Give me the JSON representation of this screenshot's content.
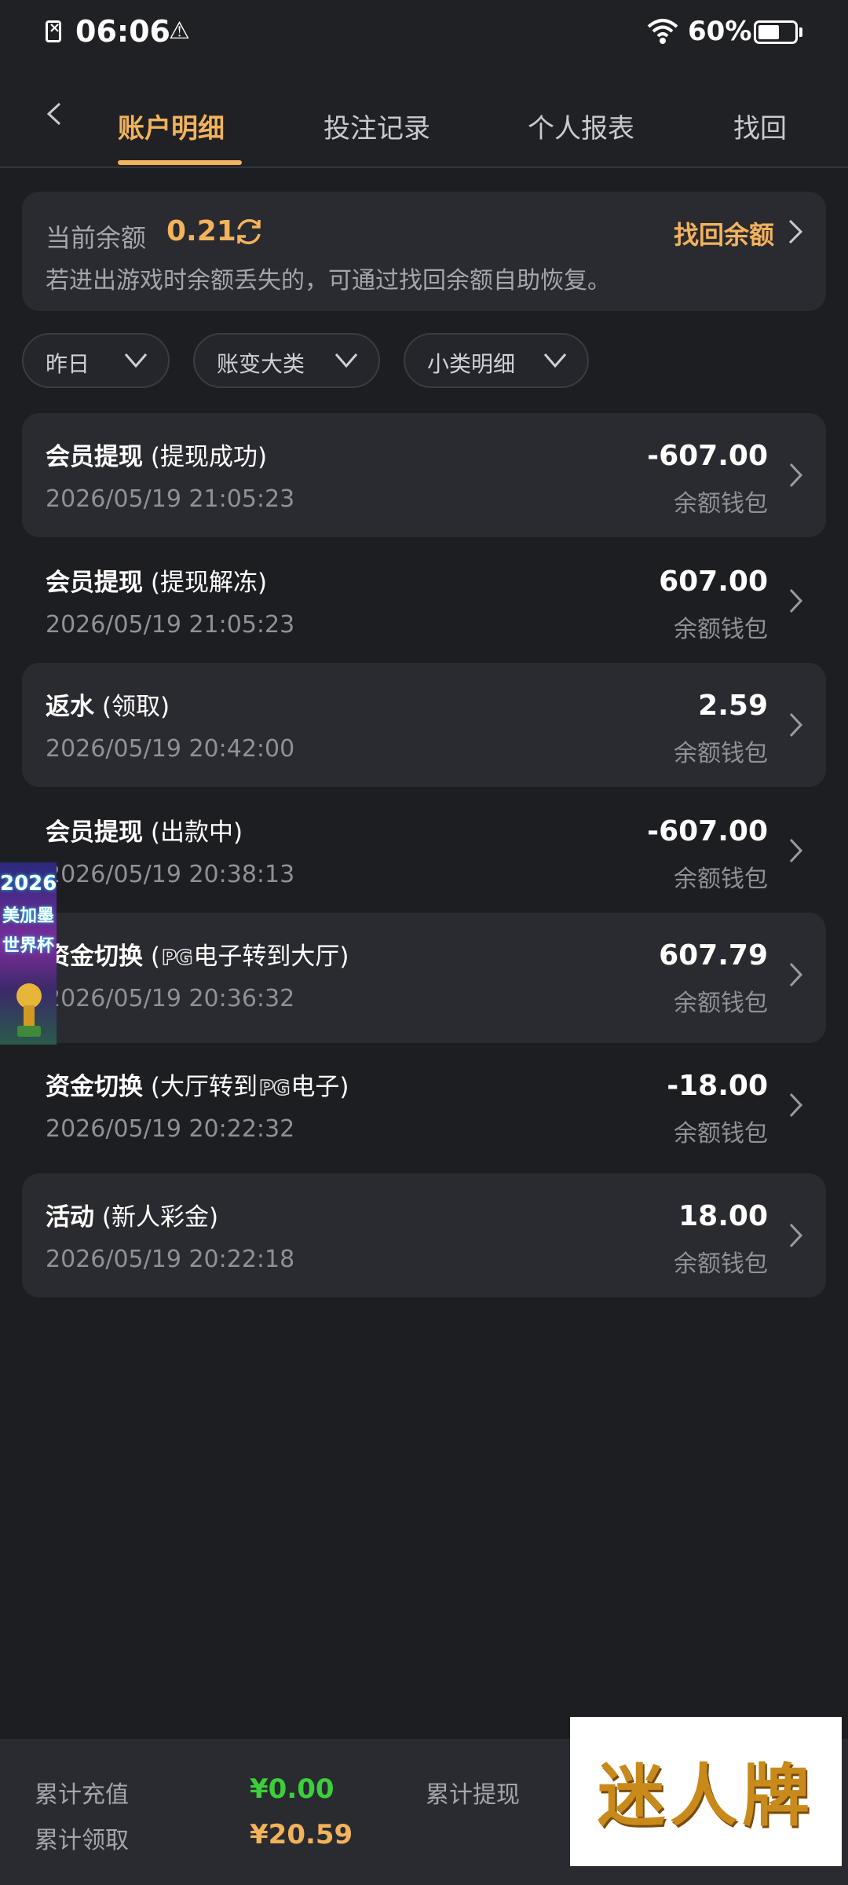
{
  "status_bar": {
    "time": "06:06",
    "battery": "60%",
    "battery_level": 0.6
  },
  "tabs": [
    {
      "label": "账户明细",
      "active": true
    },
    {
      "label": "投注记录",
      "active": false
    },
    {
      "label": "个人报表",
      "active": false
    },
    {
      "label": "找回",
      "active": false
    }
  ],
  "balance": {
    "label": "当前余额",
    "value": "0.21",
    "recover_label": "找回余额",
    "note": "若进出游戏时余额丢失的，可通过找回余额自助恢复。"
  },
  "filters": [
    {
      "label": "昨日"
    },
    {
      "label": "账变大类"
    },
    {
      "label": "小类明细"
    }
  ],
  "records": [
    {
      "title": "会员提现",
      "detail": " (提现成功)",
      "time": "2026/05/19 21:05:23",
      "amount": "-607.00",
      "wallet": "余额钱包"
    },
    {
      "title": "会员提现",
      "detail": " (提现解冻)",
      "time": "2026/05/19 21:05:23",
      "amount": "607.00",
      "wallet": "余额钱包"
    },
    {
      "title": "返水",
      "detail": " (领取)",
      "time": "2026/05/19 20:42:00",
      "amount": "2.59",
      "wallet": "余额钱包"
    },
    {
      "title": "会员提现",
      "detail": " (出款中)",
      "time": "2026/05/19 20:38:13",
      "amount": "-607.00",
      "wallet": "余额钱包"
    },
    {
      "title": "资金切换",
      "detail_pre": " (",
      "logo": "PG",
      "detail_post": "电子转到大厅)",
      "time": "2026/05/19 20:36:32",
      "amount": "607.79",
      "wallet": "余额钱包"
    },
    {
      "title": "资金切换",
      "detail_pre": " (大厅转到",
      "logo": "PG",
      "detail_post": "电子)",
      "time": "2026/05/19 20:22:32",
      "amount": "-18.00",
      "wallet": "余额钱包"
    },
    {
      "title": "活动",
      "detail": " (新人彩金)",
      "time": "2026/05/19 20:22:18",
      "amount": "18.00",
      "wallet": "余额钱包"
    }
  ],
  "banner": {
    "line1": "2026",
    "line2": "美加墨",
    "line3": "世界杯"
  },
  "summary": {
    "recharge_label": "累计充值",
    "recharge_value": "¥0.00",
    "withdraw_label": "累计提现",
    "claim_label": "累计领取",
    "claim_value": "¥20.59"
  },
  "brand": {
    "text": "迷人牌"
  },
  "colors": {
    "accent": "#f2b35c",
    "positive_green": "#3ccf3c",
    "background": "#1d1e22",
    "card": "#2a2b30"
  }
}
